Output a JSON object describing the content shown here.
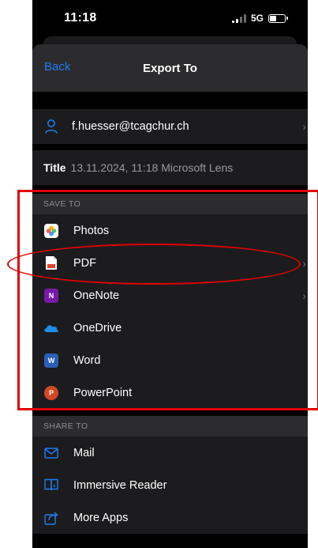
{
  "status_bar": {
    "time": "11:18",
    "network": "5G"
  },
  "nav": {
    "back_label": "Back",
    "title": "Export To"
  },
  "account": {
    "email": "f.huesser@tcagchur.ch"
  },
  "document": {
    "title_label": "Title",
    "title_value": "13.11.2024, 11:18 Microsoft Lens"
  },
  "save_to": {
    "header": "SAVE TO",
    "items": [
      {
        "label": "Photos",
        "icon": "photos-icon"
      },
      {
        "label": "PDF",
        "icon": "pdf-icon"
      },
      {
        "label": "OneNote",
        "icon": "onenote-icon"
      },
      {
        "label": "OneDrive",
        "icon": "onedrive-icon"
      },
      {
        "label": "Word",
        "icon": "word-icon"
      },
      {
        "label": "PowerPoint",
        "icon": "powerpoint-icon"
      }
    ]
  },
  "share_to": {
    "header": "SHARE TO",
    "items": [
      {
        "label": "Mail",
        "icon": "mail-icon"
      },
      {
        "label": "Immersive Reader",
        "icon": "immersive-reader-icon"
      },
      {
        "label": "More Apps",
        "icon": "share-icon"
      }
    ]
  },
  "colors": {
    "accent": "#1e7cf0",
    "annotation": "#e00000",
    "row_bg": "#1c1c1e",
    "header_bg": "#2c2c2e"
  }
}
